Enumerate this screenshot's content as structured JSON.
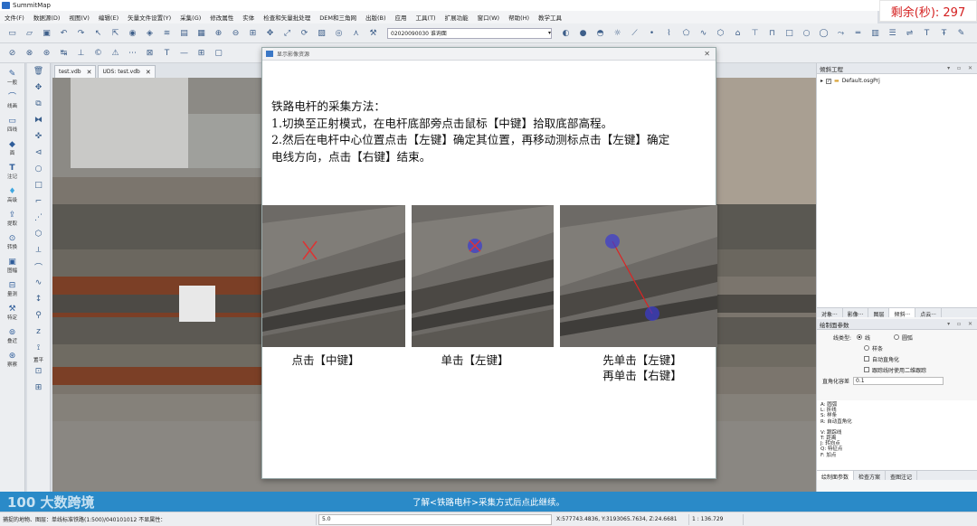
{
  "app": {
    "title": "SummitMap",
    "timer": "剩余(秒): 297"
  },
  "menu": [
    "文件(F)",
    "数据源(D)",
    "视图(V)",
    "编辑(E)",
    "矢量文件设置(Y)",
    "采集(G)",
    "修改属性",
    "实体",
    "检查和矢量批处理",
    "DEM和三角网",
    "出版(B)",
    "应用",
    "工具(T)",
    "扩展功能",
    "窗口(W)",
    "帮助(H)",
    "教学工具"
  ],
  "toolbar": {
    "project_select": "02020090030 谁询面"
  },
  "leftbar": [
    "一般",
    "线画",
    "四线",
    "面",
    "注记",
    "高级",
    "提取",
    "转换",
    "图幅",
    "量测",
    "特定",
    "叠近",
    "察察"
  ],
  "toolcol_label": "置平",
  "tabs": [
    {
      "label": "test.vdb"
    },
    {
      "label": "UDS: test.vdb"
    }
  ],
  "dialog": {
    "title": "显示影像资源",
    "instructions": [
      "铁路电杆的采集方法：",
      "1.切换至正射模式，在电杆底部旁点击鼠标【中键】拾取底部高程。",
      "2.然后在电杆中心位置点击【左键】确定其位置，再移动测标点击【左键】确定",
      "电线方向，点击【右键】结束。"
    ],
    "captions": {
      "c1": "点击【中键】",
      "c2": "单击【左键】",
      "c3a": "先单击【左键】",
      "c3b": "再单击【右键】"
    }
  },
  "right": {
    "top_title": "倾斜工程",
    "tree_item": "Default.osgPrj",
    "top_tabs": [
      "对象···",
      "影像···",
      "图层",
      "倾斜···",
      "点云···"
    ],
    "params_title": "绘制面参数",
    "line_type_label": "线类型:",
    "radio_line": "线",
    "radio_arc": "圆弧",
    "radio_spline": "样条",
    "chk_auto_right": "自动直角化",
    "chk_2d": "跟踪线时使用二维跟踪",
    "right_angle_label": "直角化容差",
    "right_angle_value": "0.1",
    "shortcuts": [
      "A: 圆弧",
      "L: 折线",
      "S: 样条",
      "R: 自动直角化",
      "",
      "V: 跟踪线",
      "T: 距离",
      "J: 转向点",
      "Q: 特征点",
      "F: 加点"
    ],
    "bottom_tabs": [
      "绘制面参数",
      "检查方案",
      "查图注记"
    ]
  },
  "hint": "了解<铁路电杆>采集方式后点此继续。",
  "brand": "100 大数跨境",
  "status": {
    "left": "捕捉的地物、图层：单线标准铁路(1:500)/040101012 不显属性：",
    "input": "5.0",
    "coords": "X:577743.4836, Y:3193065.7634, Z:24.6681",
    "scale": "1 : 136.729"
  }
}
